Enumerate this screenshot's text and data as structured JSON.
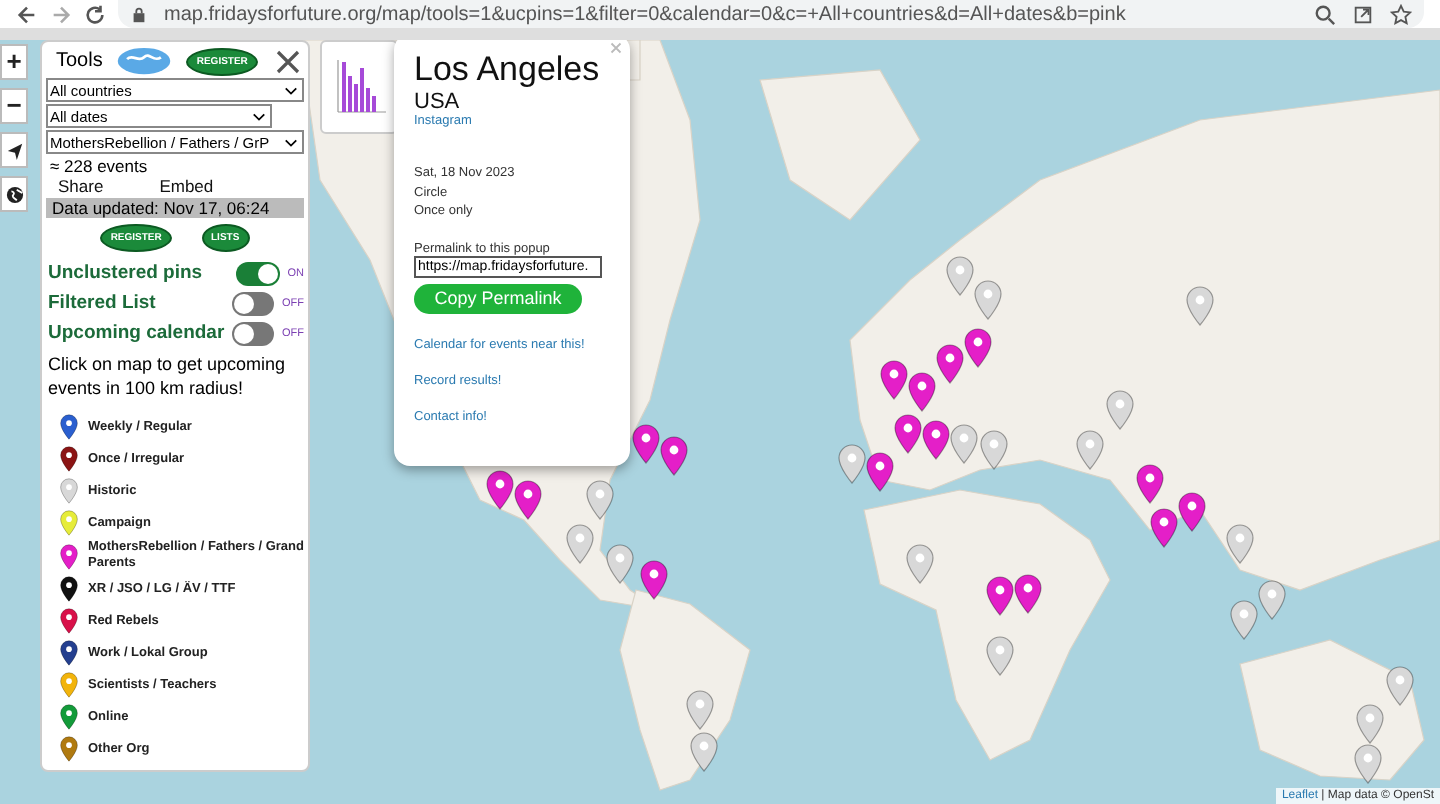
{
  "browser": {
    "url": "map.fridaysforfuture.org/map/tools=1&ucpins=1&filter=0&calendar=0&c=+All+countries&d=All+dates&b=pink"
  },
  "map_controls": [
    "+",
    "−"
  ],
  "tools": {
    "title": "Tools",
    "badge_top": "REGISTER",
    "selects": [
      {
        "value": "All countries"
      },
      {
        "value": "All dates"
      },
      {
        "value": "MothersRebellion / Fathers / GrP"
      }
    ],
    "event_count": "≈ 228 events",
    "links": [
      "Share",
      "Embed"
    ],
    "updated": "Data updated: Nov 17, 06:24",
    "badges": [
      "REGISTER",
      "LISTS"
    ],
    "toggles": [
      {
        "label": "Unclustered pins",
        "on": true,
        "state_label": "ON"
      },
      {
        "label": "Filtered List",
        "on": false,
        "state_label": "OFF"
      },
      {
        "label": "Upcoming calendar",
        "on": false,
        "state_label": "OFF"
      }
    ],
    "hint": "Click on map to get upcoming events in 100 km radius!",
    "legend": [
      {
        "label": "Weekly / Regular",
        "color": "#2a5fcf"
      },
      {
        "label": "Once / Irregular",
        "color": "#8b1414"
      },
      {
        "label": "Historic",
        "color": "#d8d8d8"
      },
      {
        "label": "Campaign",
        "color": "#e6ec3a"
      },
      {
        "label": "MothersRebellion / Fathers / Grand Parents",
        "color": "#e41fc8"
      },
      {
        "label": "XR / JSO / LG / ÄV / TTF",
        "color": "#111111"
      },
      {
        "label": "Red Rebels",
        "color": "#d8114a"
      },
      {
        "label": "Work / Lokal Group",
        "color": "#243f8f"
      },
      {
        "label": "Scientists / Teachers",
        "color": "#f2b40c"
      },
      {
        "label": "Online",
        "color": "#139b3a"
      },
      {
        "label": "Other Org",
        "color": "#b07a10"
      }
    ]
  },
  "popup": {
    "title": "Los Angeles",
    "country": "USA",
    "link": "Instagram",
    "details": [
      "Sat, 18 Nov 2023",
      "Circle",
      "Once only"
    ],
    "permalink_label": "Permalink to this popup",
    "permalink_value": "https://map.fridaysforfuture.",
    "button": "Copy Permalink",
    "links": [
      "Calendar for events near this!",
      "Record results!",
      "Contact info!"
    ]
  },
  "attribution": {
    "link": "Leaflet",
    "text": "| Map data © OpenSt"
  }
}
